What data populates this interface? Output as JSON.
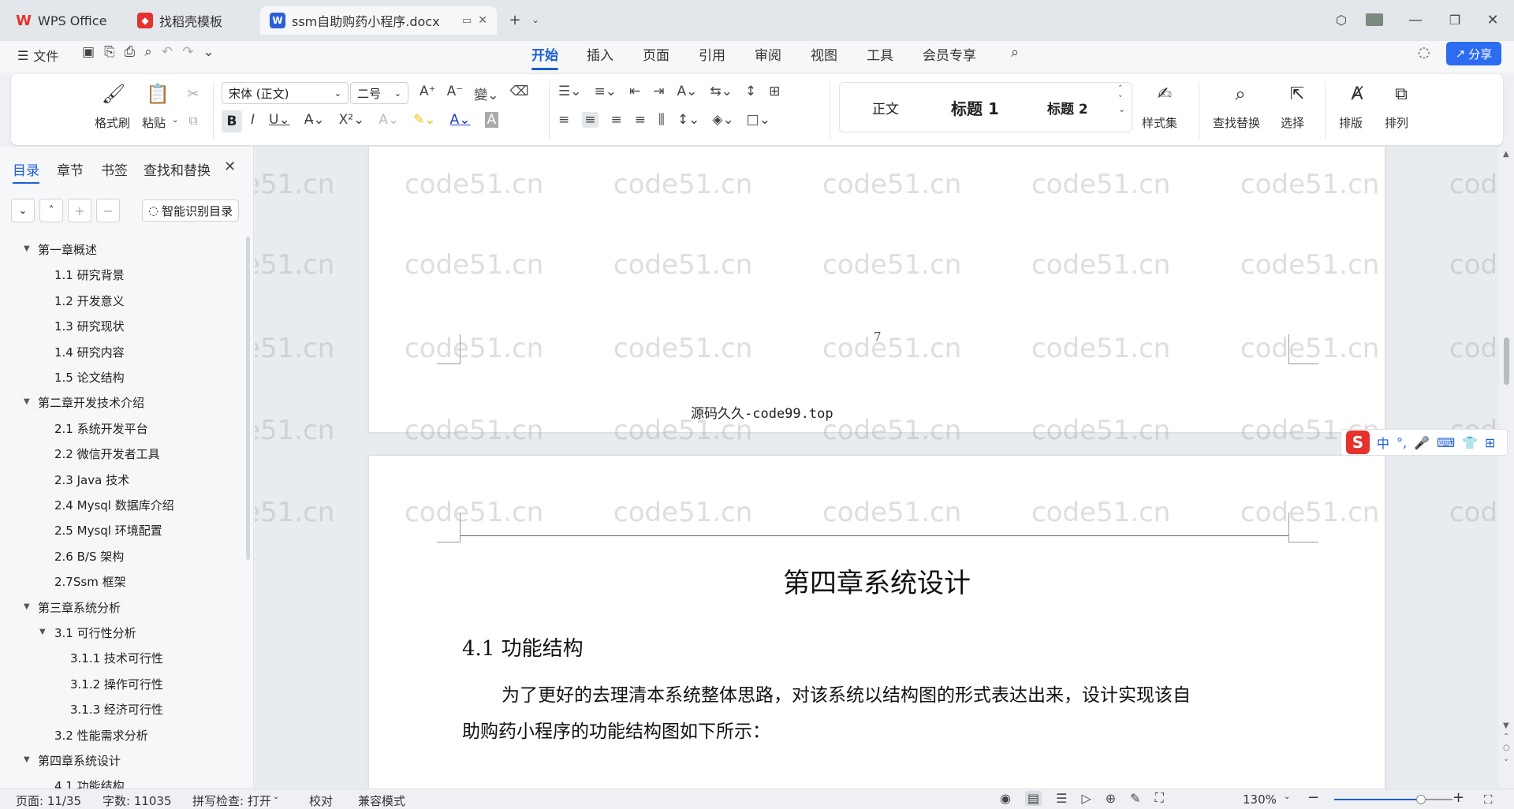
{
  "tabs": [
    {
      "label": "WPS Office"
    },
    {
      "label": "找稻壳模板"
    },
    {
      "label": "ssm自助购药小程序.docx"
    }
  ],
  "menu": {
    "file": "文件",
    "items": [
      "开始",
      "插入",
      "页面",
      "引用",
      "审阅",
      "视图",
      "工具",
      "会员专享"
    ],
    "share": "分享"
  },
  "ribbon": {
    "format_painter": "格式刷",
    "paste": "粘贴",
    "font": "宋体 (正文)",
    "size": "二号",
    "styles": [
      "正文",
      "标题 1",
      "标题 2"
    ],
    "style_set": "样式集",
    "find_replace": "查找替换",
    "select": "选择",
    "layout": "排版",
    "arrange": "排列"
  },
  "sidebar": {
    "tabs": [
      "目录",
      "章节",
      "书签",
      "查找和替换"
    ],
    "smart_toc": "智能识别目录",
    "toc": [
      {
        "label": "第一章概述",
        "level": 1,
        "expandable": true
      },
      {
        "label": "1.1 研究背景",
        "level": 2
      },
      {
        "label": "1.2 开发意义",
        "level": 2
      },
      {
        "label": "1.3  研究现状",
        "level": 2
      },
      {
        "label": "1.4  研究内容",
        "level": 2
      },
      {
        "label": "1.5 论文结构",
        "level": 2
      },
      {
        "label": "第二章开发技术介绍",
        "level": 1,
        "expandable": true
      },
      {
        "label": "2.1  系统开发平台",
        "level": 2
      },
      {
        "label": "2.2 微信开发者工具",
        "level": 2
      },
      {
        "label": "2.3 Java 技术",
        "level": 2
      },
      {
        "label": "2.4 Mysql 数据库介绍",
        "level": 2
      },
      {
        "label": "2.5 Mysql 环境配置",
        "level": 2
      },
      {
        "label": "2.6 B/S 架构",
        "level": 2
      },
      {
        "label": "2.7Ssm 框架",
        "level": 2
      },
      {
        "label": "第三章系统分析",
        "level": 1,
        "expandable": true
      },
      {
        "label": "3.1  可行性分析",
        "level": 2,
        "expandable": true
      },
      {
        "label": "3.1.1 技术可行性",
        "level": 3
      },
      {
        "label": "3.1.2 操作可行性",
        "level": 3
      },
      {
        "label": "3.1.3 经济可行性",
        "level": 3
      },
      {
        "label": "3.2 性能需求分析",
        "level": 2
      },
      {
        "label": "第四章系统设计",
        "level": 1,
        "expandable": true
      },
      {
        "label": "4.1 功能结构",
        "level": 2
      }
    ]
  },
  "document": {
    "page_number": "7",
    "footer": "源码久久-code99.top",
    "chapter_title": "第四章系统设计",
    "section_title": "4.1 功能结构",
    "paragraph_line1": "为了更好的去理清本系统整体思路，对该系统以结构图的形式表达出来，设计实现该自",
    "paragraph_line2": "助购药小程序的功能结构图如下所示：",
    "watermark": "code51.cn"
  },
  "ime": {
    "mode": "中"
  },
  "status": {
    "page": "页面: 11/35",
    "words": "字数: 11035",
    "spell": "拼写检查: 打开",
    "proof": "校对",
    "compat": "兼容模式",
    "zoom": "130%",
    "zoom_fraction": 0.73
  },
  "colors": {
    "accent": "#1a5fd6",
    "wps_red": "#e5322d"
  }
}
